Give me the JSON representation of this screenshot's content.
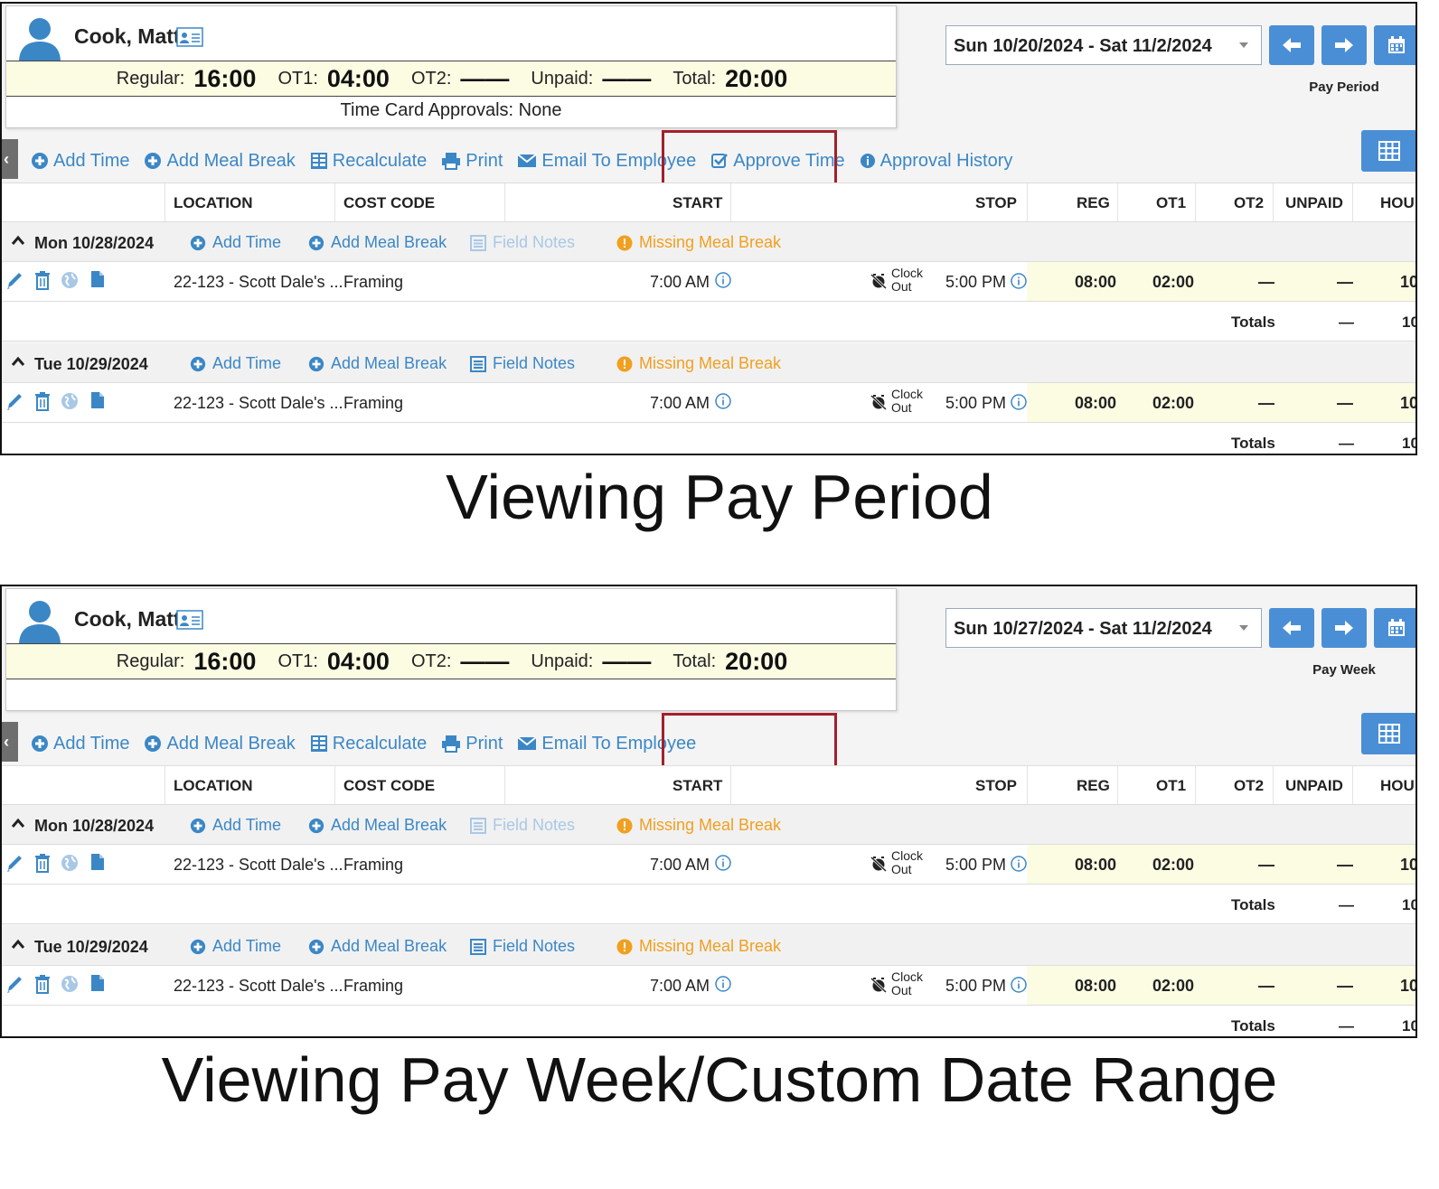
{
  "panels": [
    {
      "employee_name": "Cook, Matt",
      "summary": {
        "regular_label": "Regular:",
        "regular": "16:00",
        "ot1_label": "OT1:",
        "ot1": "04:00",
        "ot2_label": "OT2:",
        "ot2": "——",
        "unpaid_label": "Unpaid:",
        "unpaid": "——",
        "total_label": "Total:",
        "total": "20:00"
      },
      "approvals": "Time Card Approvals: None",
      "date_range": "Sun 10/20/2024 - Sat 11/2/2024",
      "period_label": "Pay Period",
      "caption": "Viewing Pay Period"
    },
    {
      "employee_name": "Cook, Matt",
      "summary": {
        "regular_label": "Regular:",
        "regular": "16:00",
        "ot1_label": "OT1:",
        "ot1": "04:00",
        "ot2_label": "OT2:",
        "ot2": "——",
        "unpaid_label": "Unpaid:",
        "unpaid": "——",
        "total_label": "Total:",
        "total": "20:00"
      },
      "approvals": "",
      "date_range": "Sun 10/27/2024 - Sat 11/2/2024",
      "period_label": "Pay Week",
      "caption": "Viewing Pay Week/Custom Date Range"
    }
  ],
  "toolbar": {
    "add_time": "Add Time",
    "add_meal_break": "Add Meal Break",
    "recalculate": "Recalculate",
    "print": "Print",
    "email": "Email To Employee",
    "approve": "Approve Time",
    "history": "Approval History"
  },
  "columns": {
    "location": "LOCATION",
    "cost_code": "COST CODE",
    "start": "START",
    "stop": "STOP",
    "reg": "REG",
    "ot1": "OT1",
    "ot2": "OT2",
    "unpaid": "UNPAID",
    "hours": "HOU"
  },
  "day_actions": {
    "add_time": "Add Time",
    "add_meal_break": "Add Meal Break",
    "field_notes": "Field Notes",
    "missing_meal_break": "Missing Meal Break"
  },
  "days": [
    {
      "date": "Mon 10/28/2024",
      "location": "22-123 - Scott Dale's ...",
      "cost_code": "Framing",
      "start": "7:00 AM",
      "clock_1": "Clock",
      "clock_2": "Out",
      "stop": "5:00 PM",
      "reg": "08:00",
      "ot1": "02:00",
      "ot2": "—",
      "unpaid": "—",
      "hours": "10",
      "totals_label": "Totals",
      "totals_unpaid": "—",
      "totals_hours": "10"
    },
    {
      "date": "Tue 10/29/2024",
      "location": "22-123 - Scott Dale's ...",
      "cost_code": "Framing",
      "start": "7:00 AM",
      "clock_1": "Clock",
      "clock_2": "Out",
      "stop": "5:00 PM",
      "reg": "08:00",
      "ot1": "02:00",
      "ot2": "—",
      "unpaid": "—",
      "hours": "10",
      "totals_label": "Totals",
      "totals_unpaid": "—",
      "totals_hours": "10"
    }
  ],
  "colors": {
    "accent": "#3b87c6",
    "button": "#4a8fd6",
    "warning": "#f0a020",
    "highlight_box": "#a3202a",
    "summary_bg": "#fcfce3"
  }
}
